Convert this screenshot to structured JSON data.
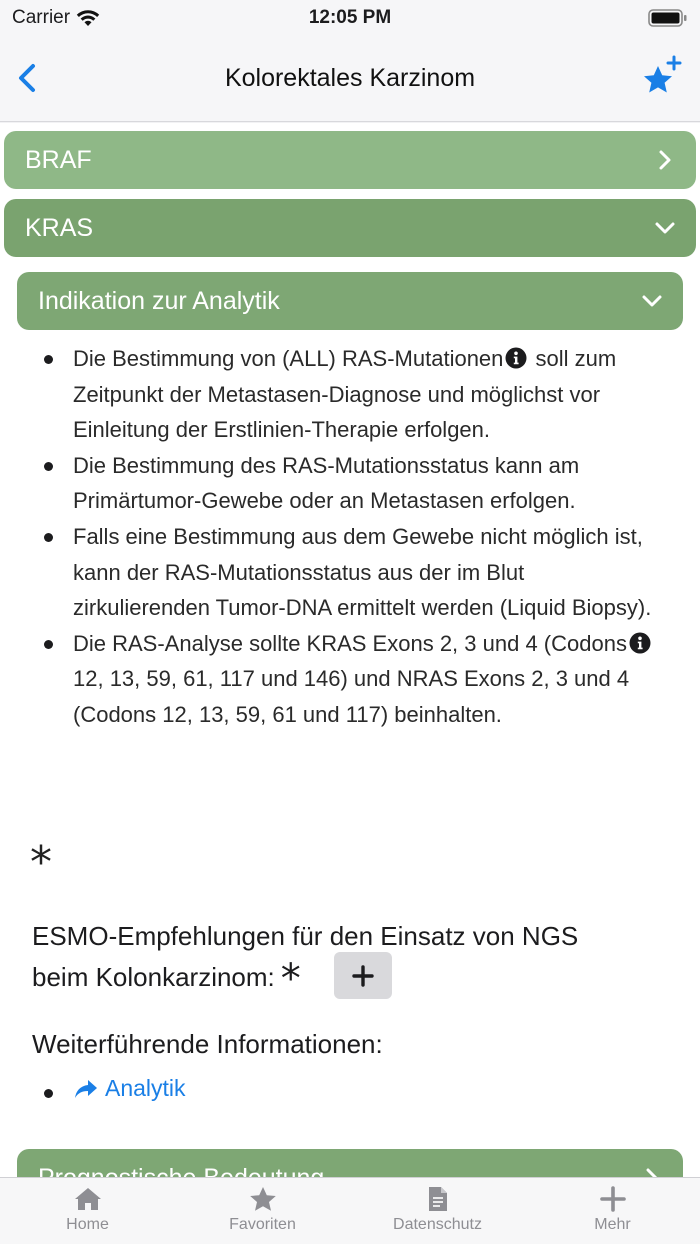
{
  "status_bar": {
    "carrier": "Carrier",
    "time": "12:05 PM"
  },
  "nav": {
    "title": "Kolorektales Karzinom",
    "back_icon": "chevron-left-icon",
    "action_icon": "star-plus-icon",
    "accent": "#1a7fe6"
  },
  "sections": {
    "braf": {
      "label": "BRAF"
    },
    "kras": {
      "label": "KRAS"
    },
    "indikation": {
      "label": "Indikation zur Analytik"
    },
    "prognostisch": {
      "label": "Prognostische Bedeutung"
    }
  },
  "bullets": [
    {
      "pre": "Die Bestimmung von (ALL) RAS-Mutationen",
      "post": " soll zum Zeitpunkt der Metastasen-Diagnose und möglichst vor Einleitung der Erstlinien-Therapie erfolgen."
    },
    {
      "text": "Die Bestimmung des RAS-Mutationsstatus kann am Primärtumor-Gewebe oder an Metastasen erfolgen."
    },
    {
      "text": "Falls eine Bestimmung aus dem Gewebe nicht möglich ist, kann der RAS-Mutationsstatus aus der im Blut zirkulierenden Tumor-DNA ermittelt werden (Liquid Biopsy)."
    },
    {
      "pre": "Die RAS-Analyse sollte KRAS Exons 2, 3 und 4 (Codons",
      "post": " 12, 13, 59, 61, 117 und 146) und NRAS Exons 2, 3 und 4 (Codons 12, 13, 59, 61 und 117) beinhalten."
    }
  ],
  "asterisk": "*",
  "esmo": {
    "line1": "ESMO-Empfehlungen für den Einsatz von NGS",
    "line2": "beim Kolonkarzinom:",
    "star": "*",
    "plus": "+"
  },
  "more_info": {
    "title": "Weiterführende Informationen:",
    "links": [
      {
        "label": "Analytik",
        "icon": "share-arrow-icon"
      }
    ]
  },
  "tabs": [
    {
      "label": "Home",
      "icon": "home-icon"
    },
    {
      "label": "Favoriten",
      "icon": "star-icon"
    },
    {
      "label": "Datenschutz",
      "icon": "document-icon"
    },
    {
      "label": "Mehr",
      "icon": "plus-icon"
    }
  ],
  "colors": {
    "accordion_green": "#8fb887",
    "accordion_green_dark": "#7aa36f",
    "link_blue": "#1a7fe6"
  }
}
